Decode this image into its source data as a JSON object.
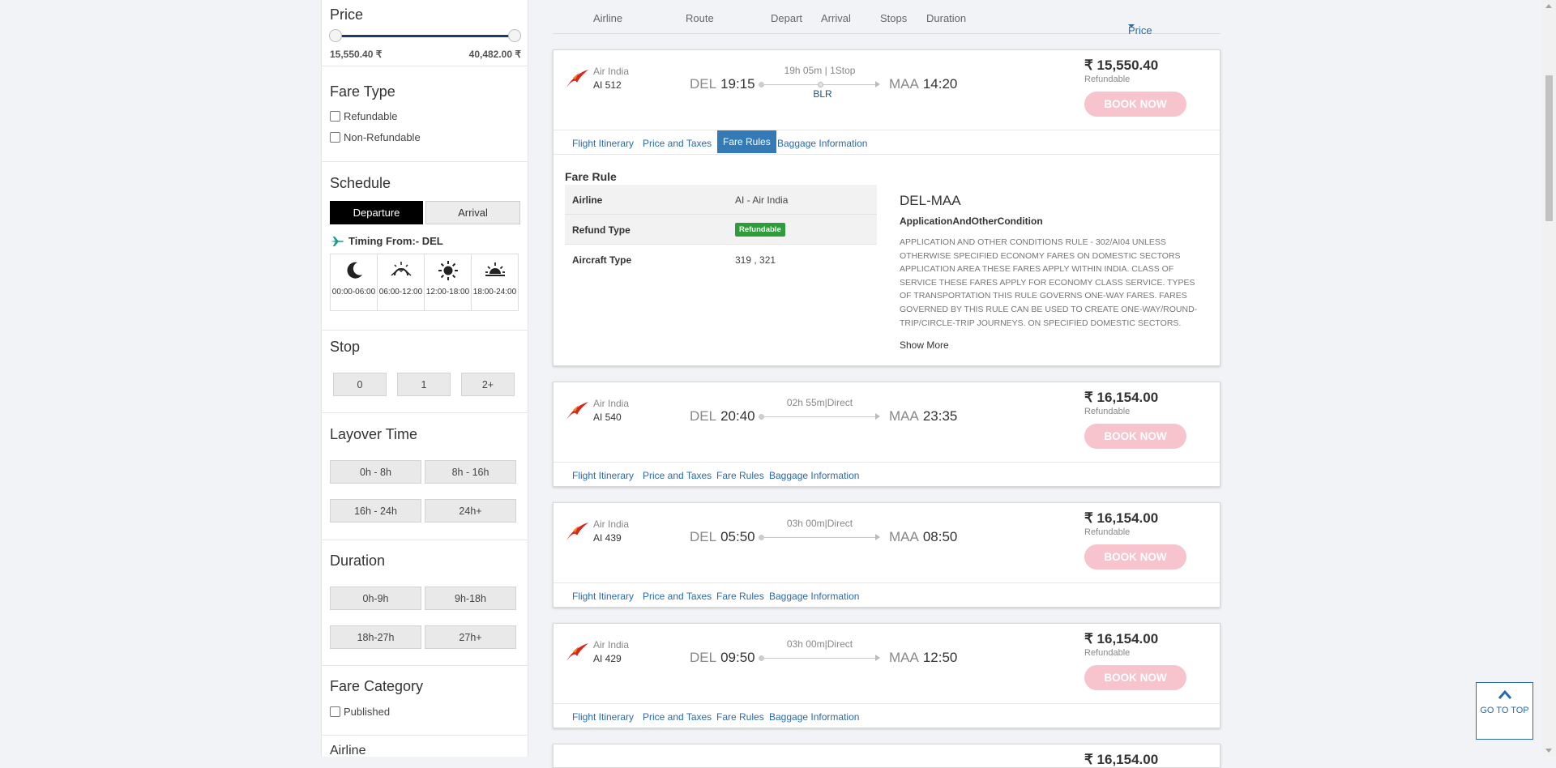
{
  "sidebar": {
    "price": {
      "title": "Price",
      "min_label": "15,550.40 ₹",
      "max_label": "40,482.00 ₹"
    },
    "fare_type": {
      "title": "Fare Type",
      "options": [
        "Refundable",
        "Non-Refundable"
      ]
    },
    "schedule": {
      "title": "Schedule",
      "tabs": [
        "Departure",
        "Arrival"
      ],
      "timing_label": "Timing From:- DEL",
      "slots": [
        "00:00-06:00",
        "06:00-12:00",
        "12:00-18:00",
        "18:00-24:00"
      ]
    },
    "stop": {
      "title": "Stop",
      "options": [
        "0",
        "1",
        "2+"
      ]
    },
    "layover": {
      "title": "Layover Time",
      "options": [
        "0h - 8h",
        "8h - 16h",
        "16h - 24h",
        "24h+"
      ]
    },
    "duration": {
      "title": "Duration",
      "options": [
        "0h-9h",
        "9h-18h",
        "18h-27h",
        "27h+"
      ]
    },
    "fare_category": {
      "title": "Fare Category",
      "options": [
        "Published"
      ]
    },
    "airline": {
      "title": "Airline"
    }
  },
  "columns": {
    "airline": "Airline",
    "route": "Route",
    "depart": "Depart",
    "arrival": "Arrival",
    "stops": "Stops",
    "duration": "Duration",
    "price": "Price"
  },
  "tab_labels": [
    "Flight Itinerary",
    "Price and Taxes",
    "Fare Rules",
    "Baggage Information"
  ],
  "book_label": "BOOK NOW",
  "flights": [
    {
      "airline": "Air India",
      "number": "AI  512",
      "dep_code": "DEL",
      "dep_time": "19:15",
      "arr_code": "MAA",
      "arr_time": "14:20",
      "duration": "19h 05m | 1Stop",
      "via": "BLR",
      "price": "₹ 15,550.40",
      "refund": "Refundable"
    },
    {
      "airline": "Air India",
      "number": "AI  540",
      "dep_code": "DEL",
      "dep_time": "20:40",
      "arr_code": "MAA",
      "arr_time": "23:35",
      "duration": "02h 55m|Direct",
      "price": "₹ 16,154.00",
      "refund": "Refundable"
    },
    {
      "airline": "Air India",
      "number": "AI  439",
      "dep_code": "DEL",
      "dep_time": "05:50",
      "arr_code": "MAA",
      "arr_time": "08:50",
      "duration": "03h 00m|Direct",
      "price": "₹ 16,154.00",
      "refund": "Refundable"
    },
    {
      "airline": "Air India",
      "number": "AI  429",
      "dep_code": "DEL",
      "dep_time": "09:50",
      "arr_code": "MAA",
      "arr_time": "12:50",
      "duration": "03h 00m|Direct",
      "price": "₹ 16,154.00",
      "refund": "Refundable"
    },
    {
      "price": "₹ 16,154.00"
    }
  ],
  "fare_rule": {
    "title": "Fare Rule",
    "rows": [
      {
        "key": "Airline",
        "value": "AI - Air India"
      },
      {
        "key": "Refund Type",
        "value": "Refundable"
      },
      {
        "key": "Aircraft Type",
        "value": "319 , 321"
      }
    ],
    "route": "DEL-MAA",
    "condition_title": "ApplicationAndOtherCondition",
    "condition_text": "APPLICATION AND OTHER CONDITIONS RULE - 302/AI04 UNLESS OTHERWISE SPECIFIED ECONOMY FARES ON DOMESTIC SECTORS APPLICATION AREA THESE FARES APPLY WITHIN INDIA. CLASS OF SERVICE THESE FARES APPLY FOR ECONOMY CLASS SERVICE. TYPES OF TRANSPORTATION THIS RULE GOVERNS ONE-WAY FARES. FARES GOVERNED BY THIS RULE CAN BE USED TO CREATE ONE-WAY/ROUND-TRIP/CIRCLE-TRIP JOURNEYS. ON SPECIFIED DOMESTIC SECTORS.",
    "show_more": "Show More"
  },
  "go_to_top": "GO TO TOP",
  "colors": {
    "accent": "#337ab7",
    "book_bg": "#f7c3cd",
    "refund_badge": "#2e9c3a",
    "slider": "#1d3a6b"
  },
  "icons": [
    "moon-icon",
    "sunrise-icon",
    "sun-icon",
    "sunset-icon",
    "plane-icon",
    "air-india-logo-icon",
    "chevron-up-icon",
    "caret-down-icon"
  ]
}
